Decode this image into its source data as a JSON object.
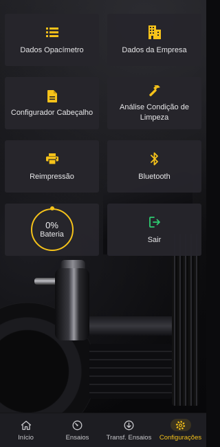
{
  "colors": {
    "accent": "#f5c21a",
    "tile_bg": "#26252c",
    "nav_bg": "#1d1d22",
    "exit_green": "#2ecc71"
  },
  "menu": {
    "tiles": [
      {
        "label": "Dados Opacímetro",
        "icon": "list-icon"
      },
      {
        "label": "Dados da Empresa",
        "icon": "building-icon"
      },
      {
        "label": "Configurador Cabeçalho",
        "icon": "document-icon"
      },
      {
        "label": "Análise Condição de Limpeza",
        "icon": "hammer-icon"
      },
      {
        "label": "Reimpressão",
        "icon": "printer-icon"
      },
      {
        "label": "Bluetooth",
        "icon": "bluetooth-icon"
      },
      {
        "label": "Sair",
        "icon": "exit-icon"
      }
    ],
    "battery": {
      "percent_text": "0%",
      "label": "Bateria",
      "level": 0
    }
  },
  "nav": {
    "items": [
      {
        "label": "Início",
        "icon": "home-icon",
        "active": false
      },
      {
        "label": "Ensaios",
        "icon": "gauge-icon",
        "active": false
      },
      {
        "label": "Transf. Ensaios",
        "icon": "download-icon",
        "active": false
      },
      {
        "label": "Configurações",
        "icon": "gear-icon",
        "active": true
      }
    ]
  }
}
